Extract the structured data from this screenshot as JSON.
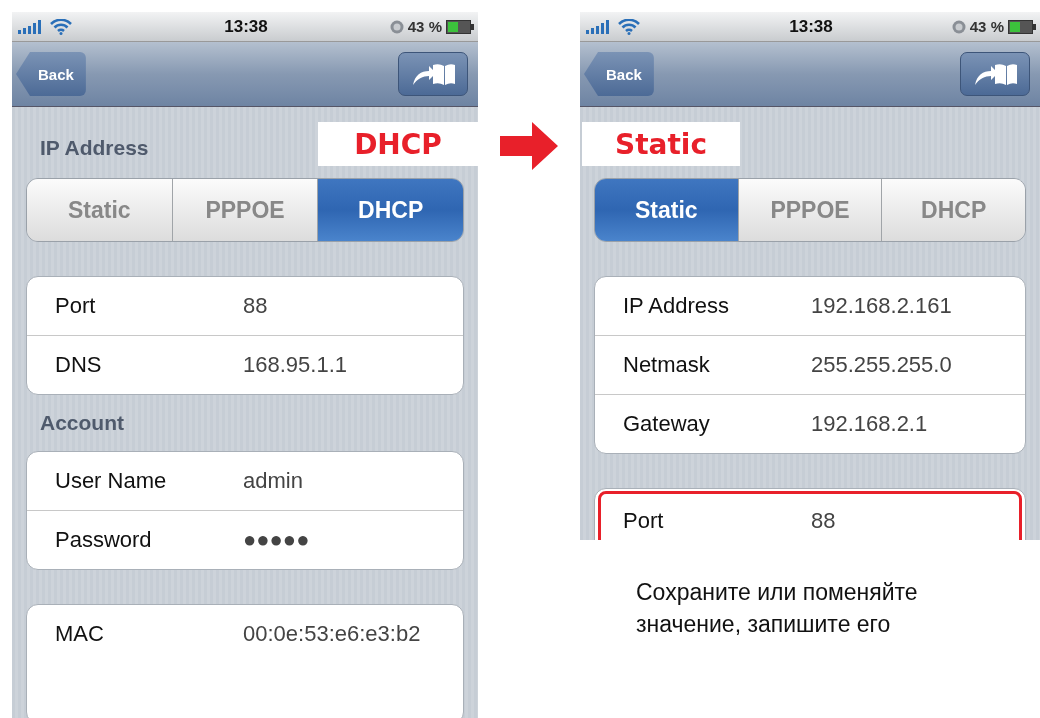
{
  "phones": [
    {
      "status_bar": {
        "time": "13:38",
        "battery": "43 %"
      },
      "nav_bar": {
        "back": "Back"
      },
      "callout": "DHCP",
      "mode_header": "IP Address",
      "segments": [
        {
          "label": "Static",
          "selected": false
        },
        {
          "label": "PPPOE",
          "selected": false
        },
        {
          "label": "DHCP",
          "selected": true
        }
      ],
      "groups": [
        {
          "rows": [
            {
              "label": "Port",
              "value": "88",
              "highlighted": false
            },
            {
              "label": "DNS",
              "value": "168.95.1.1",
              "highlighted": false
            }
          ]
        },
        {
          "header": "Account",
          "rows": [
            {
              "label": "User Name",
              "value": "admin",
              "highlighted": false
            },
            {
              "label": "Password",
              "value": "●●●●●",
              "highlighted": false
            }
          ]
        },
        {
          "rows": [
            {
              "label": "MAC",
              "value": "00:0e:53:e6:e3:b2",
              "highlighted": false
            }
          ]
        }
      ]
    },
    {
      "status_bar": {
        "time": "13:38",
        "battery": "43 %"
      },
      "nav_bar": {
        "back": "Back"
      },
      "callout": "Static",
      "segments": [
        {
          "label": "Static",
          "selected": true
        },
        {
          "label": "PPPOE",
          "selected": false
        },
        {
          "label": "DHCP",
          "selected": false
        }
      ],
      "groups": [
        {
          "rows": [
            {
              "label": "IP Address",
              "value": "192.168.2.161",
              "highlighted": false
            },
            {
              "label": "Netmask",
              "value": "255.255.255.0",
              "highlighted": false
            },
            {
              "label": "Gateway",
              "value": "192.168.2.1",
              "highlighted": false
            }
          ]
        },
        {
          "rows": [
            {
              "label": "Port",
              "value": "88",
              "highlighted": true
            }
          ]
        }
      ]
    }
  ],
  "caption": "Сохраните или поменяйте\nзначение, запишите его"
}
